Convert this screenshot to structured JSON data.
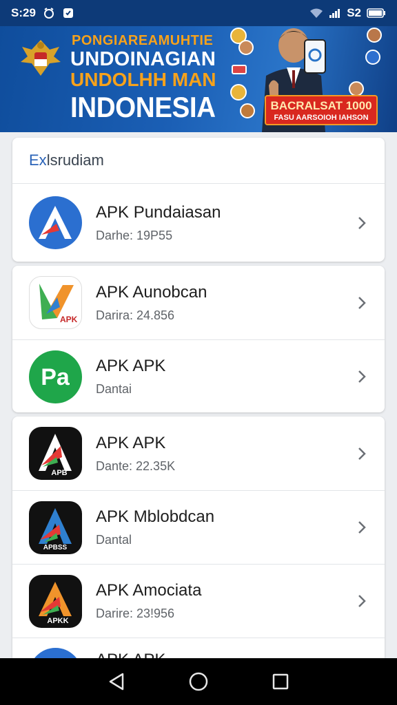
{
  "status_bar": {
    "time": "S:29",
    "right_text": "S2",
    "icons": [
      "alarm-icon",
      "shield-app-icon",
      "wifi-icon",
      "signal-icon",
      "battery-icon"
    ]
  },
  "banner": {
    "line1": "PONGIAREAMUHTIE",
    "line2": "UNDOINAGIAN",
    "line3": "UNDOLHH MAN",
    "line4": "INDONESIA",
    "promo_title": "BACRALSAT 1000",
    "promo_subtitle": "FASU AARSOIOH IAHSON"
  },
  "section_header": {
    "accent": "Ex",
    "rest": "lsrudiam"
  },
  "apps": [
    {
      "title": "APK  Pundaiasan",
      "subtitle": "Darhe: 19P55",
      "icon": "apk-a-blue-icon"
    },
    {
      "title": "APK Aunobcan",
      "subtitle": "Darira: 24.856",
      "icon": "apk-play-arrow-icon",
      "icon_label": "APK"
    },
    {
      "title": "APK APK",
      "subtitle": "Dantai",
      "icon": "apk-pa-green-icon",
      "icon_label": "Pa"
    },
    {
      "title": "APK APK",
      "subtitle": "Dante: 22.35K",
      "icon": "apk-a-dark-icon",
      "icon_label": "APB"
    },
    {
      "title": "APK Mblobdcan",
      "subtitle": "Dantal",
      "icon": "apk-a-dark-blue-icon",
      "icon_label": "APBSS"
    },
    {
      "title": "APK Amociata",
      "subtitle": "Darire: 23!956",
      "icon": "apk-a-dark-orange-icon",
      "icon_label": "APKK"
    },
    {
      "title": "APK APK",
      "subtitle": "",
      "icon": "apk-partial-icon"
    }
  ],
  "nav": [
    "back-icon",
    "home-icon",
    "recents-icon"
  ],
  "colors": {
    "accent": "#2a63b8",
    "banner": "#1b5fb5",
    "green": "#1fa64a"
  }
}
